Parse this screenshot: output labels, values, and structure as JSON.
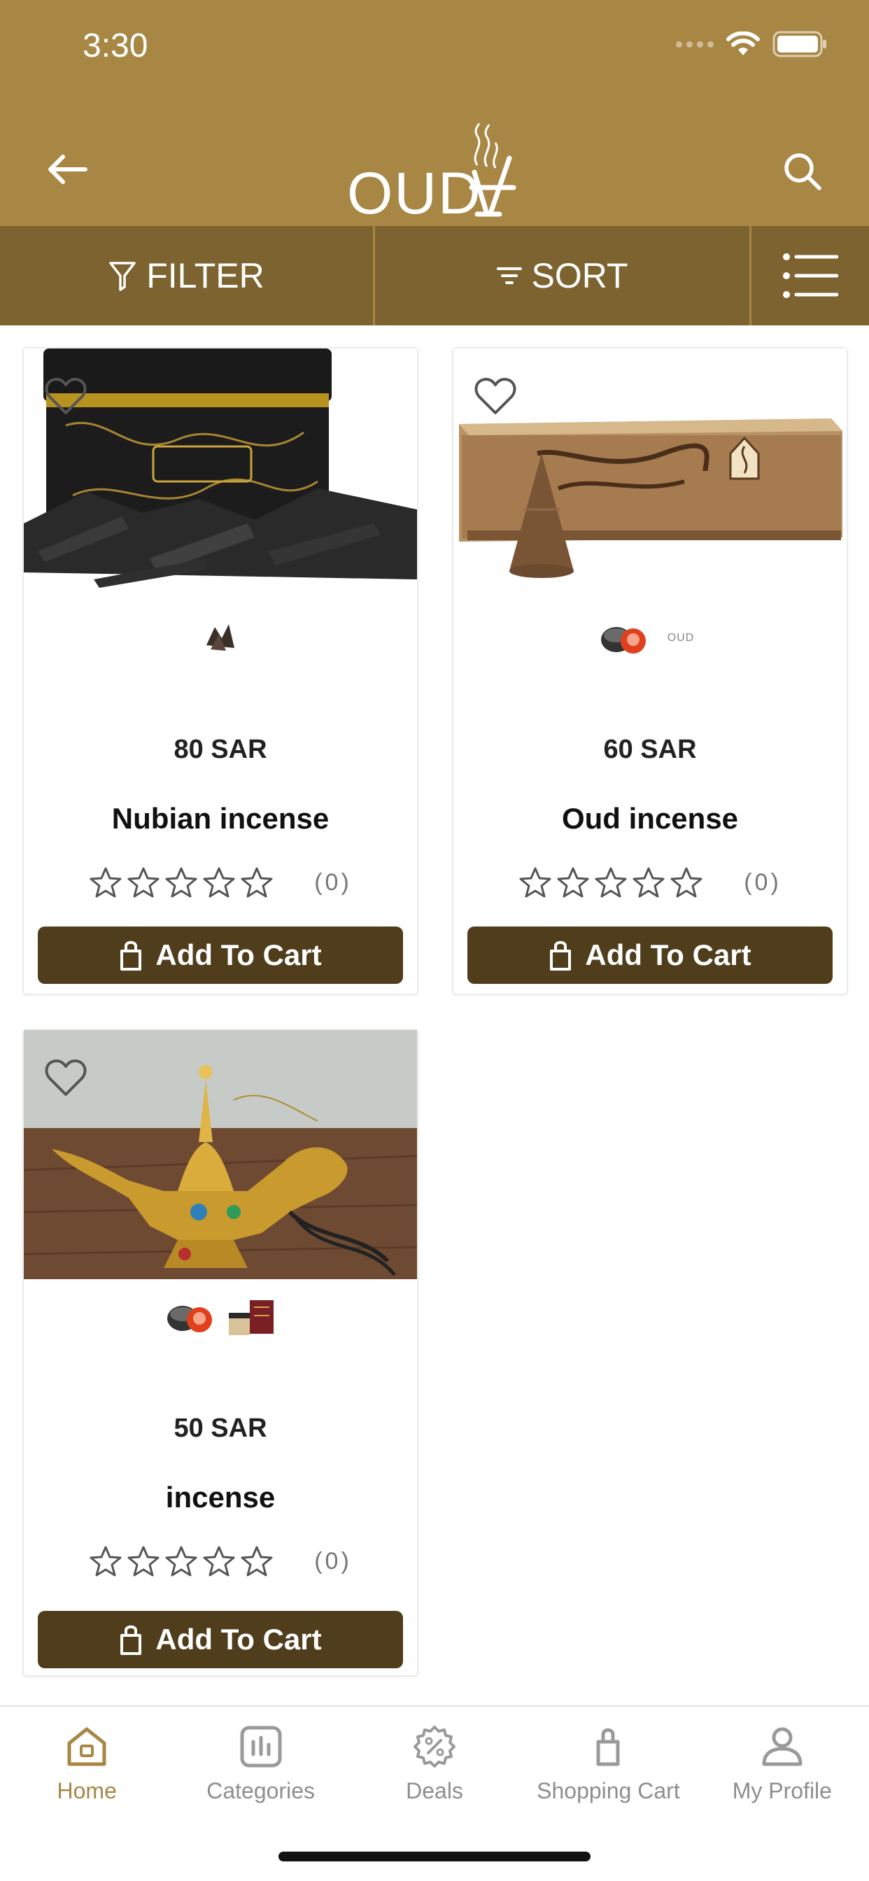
{
  "status_bar": {
    "time": "3:30"
  },
  "header": {
    "logo_text": "OUD",
    "back_icon": "arrow-left-icon",
    "search_icon": "search-icon"
  },
  "toolbar": {
    "filter_label": "FILTER",
    "sort_label": "SORT",
    "view_icon": "list-view-icon"
  },
  "products": [
    {
      "price": "80 SAR",
      "name": "Nubian incense",
      "rating_count": "(0)",
      "rating": 0,
      "cart_label": "Add To Cart"
    },
    {
      "price": "60 SAR",
      "name": "Oud incense",
      "rating_count": "(0)",
      "rating": 0,
      "cart_label": "Add To Cart",
      "thumb_logo": "OUD"
    },
    {
      "price": "50 SAR",
      "name": "incense",
      "rating_count": "(0)",
      "rating": 0,
      "cart_label": "Add To Cart"
    }
  ],
  "bottom_nav": [
    {
      "label": "Home",
      "icon": "home-icon",
      "active": true
    },
    {
      "label": "Categories",
      "icon": "categories-icon",
      "active": false
    },
    {
      "label": "Deals",
      "icon": "deals-icon",
      "active": false
    },
    {
      "label": "Shopping Cart",
      "icon": "shopping-bag-icon",
      "active": false
    },
    {
      "label": "My Profile",
      "icon": "user-icon",
      "active": false
    }
  ],
  "colors": {
    "header_bg": "#a88745",
    "toolbar_bg": "#7d6330",
    "button_bg": "#4f3d1c",
    "accent": "#a88745"
  }
}
